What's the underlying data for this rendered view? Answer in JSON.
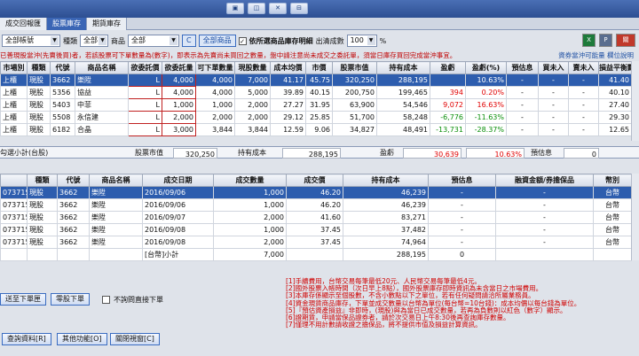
{
  "window": {
    "buttons": [
      "▣",
      "◫",
      "✕",
      "⊟"
    ]
  },
  "tabs": [
    "成交回報匯",
    "股票庫存",
    "期貨庫存"
  ],
  "toolbar": {
    "account": "全部帳號",
    "type_label": "種類",
    "type_value": "全部",
    "product_label": "商品",
    "product_value": "全部",
    "c_button": "C",
    "all_products_button": "全部商品",
    "filter_label": "依所選商品庫存明細",
    "qty_label": "出清成數",
    "qty_value": "100",
    "pct": "%"
  },
  "icons": {
    "excel": "X",
    "print": "P",
    "close": "關"
  },
  "notice": {
    "text": "已善現股當沖(先賣後買)者，若該股票可下單數量為(數字)，即表示為先賣尚未買回之數量，盤中請注意尚未成交之委託單，須當日庫存買回完成當沖事宜。",
    "link1": "資券當沖可能量",
    "link2": "欄位說明"
  },
  "main_table": {
    "headers": [
      "市場別",
      "種類",
      "代號",
      "商品名稱",
      "欲委託價",
      "欲委託量",
      "可下單數量",
      "現股數量",
      "成本均價",
      "市價",
      "股票市值",
      "持有成本",
      "盈虧",
      "盈虧(%)",
      "預估息",
      "買未入",
      "賣未入",
      "損益平衡點"
    ],
    "rows": [
      [
        "上櫃",
        "現股",
        "3662",
        "樂陞",
        "L",
        "4,000",
        "4,000",
        "7,000",
        "41.17",
        "45.75",
        "320,250",
        "288,195",
        "",
        "10.63%",
        "-",
        "-",
        "-",
        "41.40"
      ],
      [
        "上櫃",
        "現股",
        "5356",
        "協益",
        "L",
        "4,000",
        "4,000",
        "5,000",
        "39.89",
        "40.15",
        "200,750",
        "199,465",
        "394",
        "0.20%",
        "-",
        "-",
        "-",
        "40.10"
      ],
      [
        "上櫃",
        "現股",
        "5403",
        "中菲",
        "L",
        "1,000",
        "1,000",
        "2,000",
        "27.27",
        "31.95",
        "63,900",
        "54,546",
        "9,072",
        "16.63%",
        "-",
        "-",
        "-",
        "27.40"
      ],
      [
        "上櫃",
        "現股",
        "5508",
        "永信建",
        "L",
        "2,000",
        "2,000",
        "2,000",
        "29.12",
        "25.85",
        "51,700",
        "58,248",
        "-6,776",
        "-11.63%",
        "-",
        "-",
        "-",
        "29.30"
      ],
      [
        "上櫃",
        "現股",
        "6182",
        "合晶",
        "L",
        "3,000",
        "3,844",
        "3,844",
        "12.59",
        "9.06",
        "34,827",
        "48,491",
        "-13,731",
        "-28.37%",
        "-",
        "-",
        "-",
        "12.65"
      ]
    ]
  },
  "summary": {
    "label": "勾選小計(台股)",
    "mv_label": "股票市值",
    "mv_value": "320,250",
    "cost_label": "持有成本",
    "cost_value": "288,195",
    "pl_label": "盈虧",
    "pl_value": "30,639",
    "pct_value": "10.63%",
    "div_label": "預估息",
    "div_value": "0"
  },
  "detail_table": {
    "headers": [
      "",
      "種類",
      "代號",
      "商品名稱",
      "成交日期",
      "成交數量",
      "成交價",
      "持有成本",
      "預估息",
      "融資金額/券擔保品",
      "幣別"
    ],
    "rows": [
      [
        "073715",
        "現股",
        "3662",
        "樂陞",
        "2016/09/06",
        "1,000",
        "46.20",
        "46,239",
        "-",
        "-",
        "台幣"
      ],
      [
        "073715",
        "現股",
        "3662",
        "樂陞",
        "2016/09/06",
        "1,000",
        "46.20",
        "46,239",
        "-",
        "-",
        "台幣"
      ],
      [
        "073715",
        "現股",
        "3662",
        "樂陞",
        "2016/09/07",
        "2,000",
        "41.60",
        "83,271",
        "-",
        "-",
        "台幣"
      ],
      [
        "073715",
        "現股",
        "3662",
        "樂陞",
        "2016/09/08",
        "1,000",
        "37.45",
        "37,482",
        "-",
        "-",
        "台幣"
      ],
      [
        "073715",
        "現股",
        "3662",
        "樂陞",
        "2016/09/08",
        "2,000",
        "37.45",
        "74,964",
        "-",
        "-",
        "台幣"
      ]
    ],
    "subtotal_label": "[台幣]小計",
    "subtotal_qty": "7,000",
    "subtotal_cost": "288,195",
    "subtotal_div": "0"
  },
  "bottom": {
    "to_order": "送至下單匣",
    "zero_order": "零股下單",
    "no_confirm": "不詢問直接下單",
    "query": "查詢資料[R]",
    "other": "其他功能[O]",
    "close": "關閉視窗[C]"
  },
  "notes": [
    "[1]手續費用，台幣交易每筆最低20元、人民幣交易每筆最低4元。",
    "[2]國外股票入帳時間（次日早上8點），國外股票庫存即時資訊為未含當日之市場費用。",
    "[3]本庫存係顯示至個股數，不含小數點以下之單位，若有任何疑問請洽所屬業務員。",
    "[4]資金現貨商品庫存，下單並成交數量以台幣為單位(每台幣=10台錢)：成本均價以每台錢為單位。",
    "[5]『預估資產損益』非即時，(現股)與為當日已成交數量，若再為負數則以紅色（數字）顯示。",
    "[6]證期貨，申請當保品證券者，請於次交易日上午8:30後再查詢庫存數量。",
    "[7]僅理不用計數請收證之擔保品，將不提供市值及損益計算資訊。"
  ],
  "colors": {
    "profit": "#e00000",
    "loss": "#0a8f0a",
    "selected": "#2d5dae"
  }
}
